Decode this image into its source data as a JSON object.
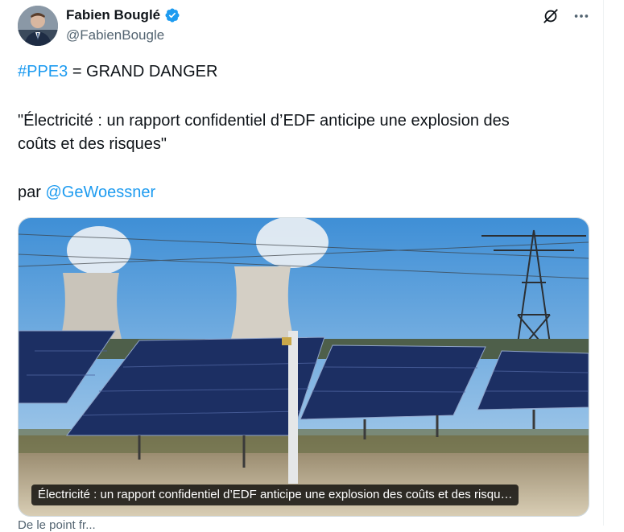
{
  "author": {
    "name": "Fabien Bouglé",
    "handle": "@FabienBougle",
    "verified": true,
    "verified_color": "#1d9bf0"
  },
  "header_icons": [
    "grok-icon",
    "more-icon"
  ],
  "tweet": {
    "hashtag": "#PPE3",
    "line1_rest": " = GRAND DANGER",
    "quote_line1": "\"Électricité : un rapport confidentiel d’EDF anticipe une explosion des",
    "quote_line2": "coûts et des risques\"",
    "by_prefix": "par ",
    "mention": "@GeWoessner"
  },
  "media": {
    "caption": "Électricité : un rapport confidentiel d’EDF anticipe une explosion des coûts et des risqu…"
  },
  "footer": {
    "source_partial": "De le point fr..."
  },
  "colors": {
    "link": "#1d9bf0",
    "text": "#0f1419",
    "secondary": "#536471"
  }
}
